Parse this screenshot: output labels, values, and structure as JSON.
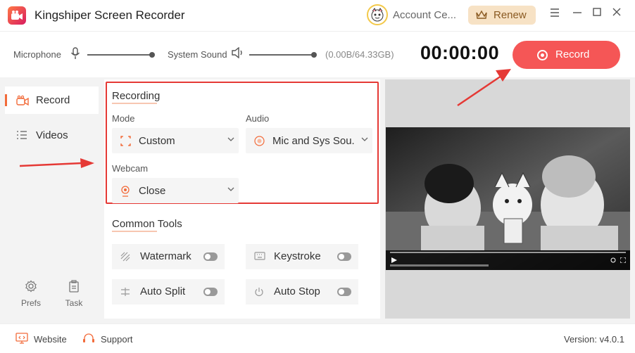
{
  "app": {
    "title": "Kingshiper Screen Recorder"
  },
  "header": {
    "account_label": "Account Ce...",
    "renew_label": "Renew",
    "window_controls": [
      "menu-icon",
      "minimize-icon",
      "maximize-icon",
      "close-icon"
    ]
  },
  "audio": {
    "microphone_label": "Microphone",
    "microphone_level": 1.0,
    "system_sound_label": "System Sound",
    "system_sound_level": 1.0,
    "storage": "(0.00B/64.33GB)",
    "timer": "00:00:00",
    "record_label": "Record"
  },
  "sidebar": {
    "items": [
      {
        "label": "Record",
        "icon": "video-camera-icon",
        "active": true
      },
      {
        "label": "Videos",
        "icon": "list-icon",
        "active": false
      }
    ],
    "bottom": [
      {
        "label": "Prefs",
        "icon": "gear-icon"
      },
      {
        "label": "Task",
        "icon": "clipboard-icon"
      }
    ]
  },
  "recording": {
    "title": "Recording",
    "mode_label": "Mode",
    "mode_value": "Custom",
    "audio_label": "Audio",
    "audio_value": "Mic and Sys Sou...",
    "webcam_label": "Webcam",
    "webcam_value": "Close"
  },
  "tools": {
    "title": "Common Tools",
    "items": [
      {
        "label": "Watermark",
        "icon": "watermark-icon",
        "enabled": false
      },
      {
        "label": "Keystroke",
        "icon": "keyboard-icon",
        "enabled": false
      },
      {
        "label": "Auto Split",
        "icon": "split-icon",
        "enabled": false
      },
      {
        "label": "Auto Stop",
        "icon": "power-icon",
        "enabled": false
      }
    ]
  },
  "footer": {
    "website_label": "Website",
    "support_label": "Support",
    "version": "Version: v4.0.1"
  },
  "colors": {
    "accent": "#f26b3a",
    "record_button": "#f55656",
    "highlight_box": "#e53935"
  }
}
